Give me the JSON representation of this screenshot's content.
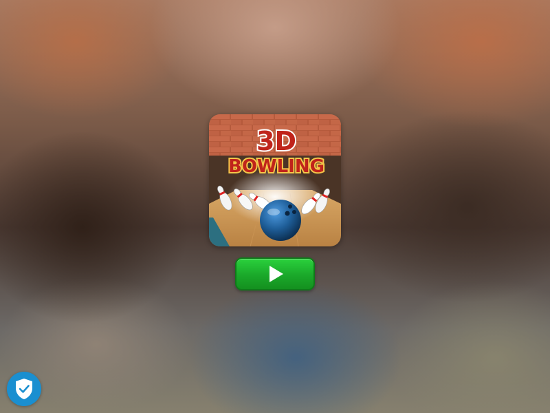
{
  "game": {
    "title_line1": "3D",
    "title_line2": "BOWLING"
  },
  "controls": {
    "play_icon": "play-icon",
    "security_icon": "shield-check-icon"
  },
  "colors": {
    "play_button": "#1aa82a",
    "shield_badge": "#1a8fd0",
    "title_red": "#c0241b",
    "title_gold": "#f5c64a",
    "ball_blue": "#1f5f9a"
  }
}
